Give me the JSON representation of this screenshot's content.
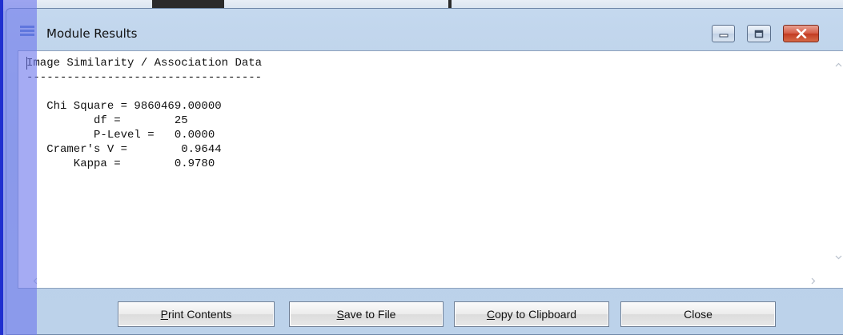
{
  "window": {
    "title": "Module Results",
    "icon": "app-icon",
    "controls": {
      "minimize": "minimize-icon",
      "maximize": "maximize-icon",
      "close": "close-icon"
    }
  },
  "results": {
    "lines": [
      "Image Similarity / Association Data",
      "-----------------------------------",
      "",
      "   Chi Square = 9860469.00000",
      "          df =        25",
      "          P-Level =   0.0000",
      "   Cramer's V =        0.9644",
      "       Kappa =        0.9780"
    ]
  },
  "buttons": {
    "print": {
      "mnemonic": "P",
      "rest": "rint Contents"
    },
    "save": {
      "mnemonic": "S",
      "rest": "ave to File"
    },
    "copy": {
      "mnemonic": "C",
      "rest": "opy to Clipboard"
    },
    "close": {
      "label": "Close"
    }
  },
  "colors": {
    "frame": "#bcd2ea",
    "overlay": "#6e78eb",
    "close_button": "#c23b22"
  }
}
